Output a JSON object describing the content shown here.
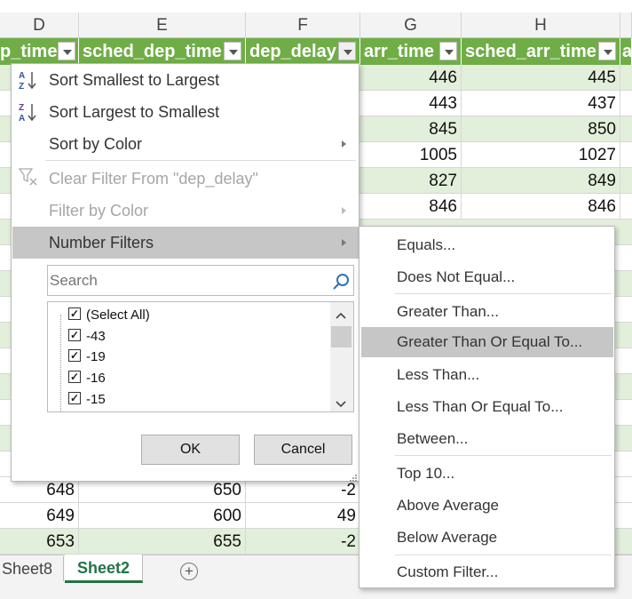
{
  "columns": {
    "d": "D",
    "e": "E",
    "f": "F",
    "g": "G",
    "h": "H"
  },
  "headers": {
    "d": "p_time",
    "e": "sched_dep_time",
    "f": "dep_delay",
    "g": "arr_time",
    "h": "sched_arr_time",
    "i": "a"
  },
  "top_rows": [
    {
      "g": "446",
      "h": "445"
    },
    {
      "g": "443",
      "h": "437"
    },
    {
      "g": "845",
      "h": "850"
    },
    {
      "g": "1005",
      "h": "1027"
    },
    {
      "g": "827",
      "h": "849"
    },
    {
      "g": "846",
      "h": "846"
    }
  ],
  "bottom_rows": [
    {
      "d": "648",
      "e": "650",
      "f": "-2"
    },
    {
      "d": "649",
      "e": "600",
      "f": "49"
    },
    {
      "d": "653",
      "e": "655",
      "f": "-2"
    }
  ],
  "filter_menu": {
    "sort_asc": "Sort Smallest to Largest",
    "sort_desc": "Sort Largest to Smallest",
    "sort_color": "Sort by Color",
    "clear_filter": "Clear Filter From \"dep_delay\"",
    "filter_color": "Filter by Color",
    "number_filters": "Number Filters",
    "search_placeholder": "Search",
    "list": [
      "(Select All)",
      "-43",
      "-19",
      "-16",
      "-15"
    ],
    "ok": "OK",
    "cancel": "Cancel"
  },
  "submenu": [
    "Equals...",
    "Does Not Equal...",
    "Greater Than...",
    "Greater Than Or Equal To...",
    "Less Than...",
    "Less Than Or Equal To...",
    "Between...",
    "Top 10...",
    "Above Average",
    "Below Average",
    "Custom Filter..."
  ],
  "tabs": {
    "sheet8": "Sheet8",
    "sheet2": "Sheet2",
    "add": "+"
  },
  "colors": {
    "table_header": "#70ad47",
    "band": "#e2efda",
    "active_tab": "#217346"
  }
}
